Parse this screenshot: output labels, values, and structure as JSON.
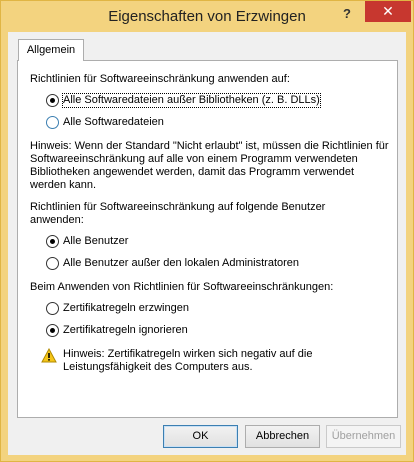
{
  "window": {
    "title": "Eigenschaften von Erzwingen",
    "help_label": "?",
    "close_label": "✕"
  },
  "tabs": [
    {
      "label": "Allgemein"
    }
  ],
  "apply_section": {
    "label": "Richtlinien für Softwareeinschränkung anwenden auf:",
    "options": [
      {
        "label": "Alle Softwaredateien außer Bibliotheken (z. B. DLLs)",
        "selected": true
      },
      {
        "label": "Alle Softwaredateien",
        "selected": false
      }
    ],
    "hint": "Hinweis: Wenn der Standard \"Nicht erlaubt\" ist, müssen die Richtlinien für Softwareeinschränkung auf alle von einem Programm verwendeten Bibliotheken angewendet werden, damit das Programm verwendet werden kann."
  },
  "users_section": {
    "label": "Richtlinien für Softwareeinschränkung auf folgende Benutzer anwenden:",
    "options": [
      {
        "label": "Alle Benutzer",
        "selected": true
      },
      {
        "label": "Alle Benutzer außer den lokalen Administratoren",
        "selected": false
      }
    ]
  },
  "cert_section": {
    "label": "Beim Anwenden von Richtlinien für Softwareeinschränkungen:",
    "options": [
      {
        "label": "Zertifikatregeln erzwingen",
        "selected": false
      },
      {
        "label": "Zertifikatregeln ignorieren",
        "selected": true
      }
    ],
    "warning": "Hinweis: Zertifikatregeln wirken sich negativ auf die Leistungsfähigkeit des Computers aus."
  },
  "buttons": {
    "ok": "OK",
    "cancel": "Abbrechen",
    "apply": "Übernehmen"
  },
  "colors": {
    "frame": "#f3d37f",
    "close": "#c7372f",
    "warning_icon": "#f5c518"
  }
}
